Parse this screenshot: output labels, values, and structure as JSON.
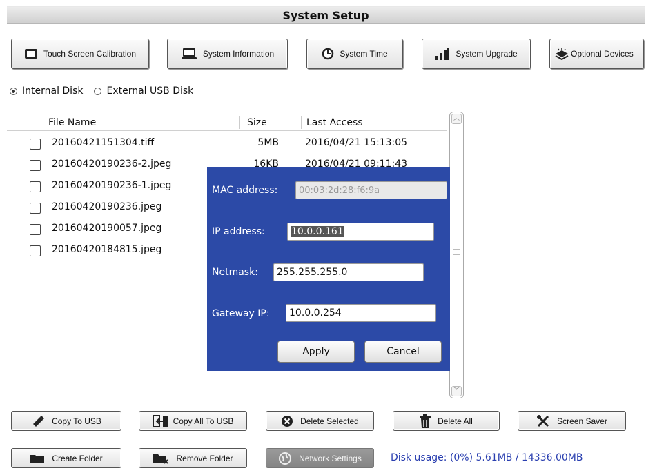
{
  "window": {
    "title": "System Setup"
  },
  "toolbar": {
    "buttons": [
      {
        "label": "Touch Screen Calibration",
        "icon": "screen-icon"
      },
      {
        "label": "System Information",
        "icon": "laptop-icon"
      },
      {
        "label": "System Time",
        "icon": "clock-icon"
      },
      {
        "label": "System Upgrade",
        "icon": "signal-bars-icon"
      },
      {
        "label": "Optional Devices",
        "icon": "device-icon"
      }
    ]
  },
  "storage": {
    "options": [
      {
        "label": "Internal Disk",
        "selected": true
      },
      {
        "label": "External USB Disk",
        "selected": false
      }
    ]
  },
  "file_list": {
    "columns": [
      "File Name",
      "Size",
      "Last Access"
    ],
    "rows": [
      {
        "name": "20160421151304.tiff",
        "size": "5MB",
        "date": "2016/04/21 15:13:05"
      },
      {
        "name": "20160420190236-2.jpeg",
        "size": "16KB",
        "date": "2016/04/21 09:11:43"
      },
      {
        "name": "20160420190236-1.jpeg",
        "size": "",
        "date": ""
      },
      {
        "name": "20160420190236.jpeg",
        "size": "",
        "date": ""
      },
      {
        "name": "20160420190057.jpeg",
        "size": "",
        "date": ""
      },
      {
        "name": "20160420184815.jpeg",
        "size": "",
        "date": ""
      }
    ]
  },
  "network_dialog": {
    "mac_label": "MAC address:",
    "mac_value": "00:03:2d:28:f6:9a",
    "ip_label": "IP address:",
    "ip_value": "10.0.0.161",
    "netmask_label": "Netmask:",
    "netmask_value": "255.255.255.0",
    "gateway_label": "Gateway IP:",
    "gateway_value": "10.0.0.254",
    "apply_label": "Apply",
    "cancel_label": "Cancel",
    "background_color": "#2c4aa7"
  },
  "actions": {
    "copy_to_usb": "Copy To USB",
    "copy_all_to_usb": "Copy All To USB",
    "delete_selected": "Delete Selected",
    "delete_all": "Delete All",
    "screen_saver": "Screen Saver",
    "create_folder": "Create Folder",
    "remove_folder": "Remove Folder",
    "network_settings": "Network Settings"
  },
  "status": {
    "disk_usage": "Disk usage: (0%) 5.61MB / 14336.00MB",
    "color": "#2a3fb0"
  }
}
